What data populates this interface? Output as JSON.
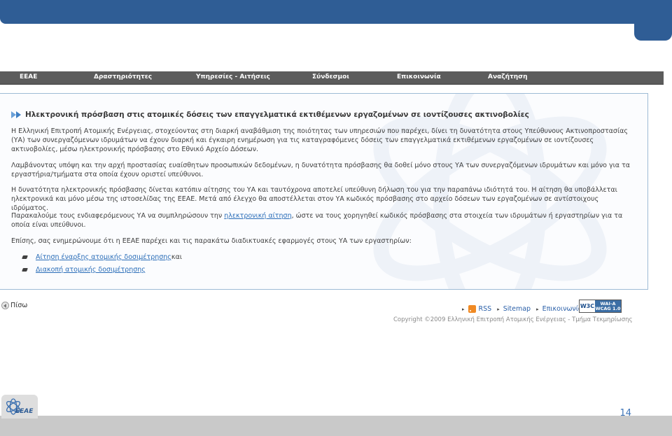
{
  "nav": {
    "items": [
      {
        "label": "ΕΕΑΕ"
      },
      {
        "label": "Δραστηριότητες"
      },
      {
        "label": "Υπηρεσίες - Αιτήσεις"
      },
      {
        "label": "Σύνδεσμοι"
      },
      {
        "label": "Επικοινωνία"
      },
      {
        "label": "Αναζήτηση"
      }
    ]
  },
  "content": {
    "heading": "Ηλεκτρονική πρόσβαση στις ατομικές δόσεις των επαγγελματικά εκτιθέμενων εργαζομένων σε ιοντίζουσες ακτινοβολίες",
    "p1": "Η Ελληνική Επιτροπή Ατομικής Ενέργειας, στοχεύοντας στη διαρκή αναβάθμιση της ποιότητας των υπηρεσιών που παρέχει, δίνει τη δυνατότητα στους Υπεύθυνους Ακτινοπροστασίας (ΥΑ) των συνεργαζόμενων ιδρυμάτων να έχουν διαρκή και έγκαιρη ενημέρωση για τις καταγραφόμενες δόσεις των επαγγελματικά εκτιθέμενων εργαζομένων σε ιοντίζουσες ακτινοβολίες, μέσω ηλεκτρονικής πρόσβασης στο Εθνικό Αρχείο Δόσεων.",
    "p2": "Λαμβάνοντας υπόψη και την αρχή προστασίας ευαίσθητων προσωπικών δεδομένων, η δυνατότητα πρόσβασης θα δοθεί μόνο στους ΥΑ των συνεργαζόμενων ιδρυμάτων και μόνο για τα εργαστήρια/τμήματα στα οποία έχουν οριστεί υπεύθυνοι.",
    "p3": "Η δυνατότητα ηλεκτρονικής πρόσβασης δίνεται κατόπιν αίτησης του ΥΑ και ταυτόχρονα αποτελεί υπεύθυνη δήλωση του για την παραπάνω ιδιότητά του. Η αίτηση θα υποβάλλεται ηλεκτρονικά και μόνο μέσω της ιστοσελίδας της ΕΕΑΕ. Μετά από έλεγχο θα αποστέλλεται στον ΥΑ κωδικός πρόσβασης στο αρχείο δόσεων των εργαζομένων σε αντίστοιχους ιδρύματος.",
    "p4_before": "Παρακαλούμε τους ενδιαφερόμενους ΥΑ να συμπληρώσουν την ",
    "p4_link": "ηλεκτρονική αίτηση",
    "p4_after": ", ώστε να τους χορηγηθεί κωδικός πρόσβασης στα στοιχεία των ιδρυμάτων ή εργαστηρίων για τα οποία είναι υπεύθυνοι.",
    "p5": "Επίσης, σας ενημερώνουμε ότι η ΕΕΑΕ παρέχει και τις παρακάτω διαδικτυακές εφαρμογές στους ΥΑ των εργαστηρίων:",
    "bullets": [
      {
        "link": "Αίτηση έναρξης ατομικής δοσιμέτρησης",
        "suffix": " και"
      },
      {
        "link": "Διακοπή ατομικής δοσιμέτρησης",
        "suffix": ""
      }
    ]
  },
  "footer": {
    "back": "Πίσω",
    "rss": "RSS",
    "sitemap": "Sitemap",
    "contact": "Επικοινωνία",
    "wai_left": "W3C",
    "wai_top": "WAI-A",
    "wai_bottom": "WCAG 1.0",
    "copyright": "Copyright ©2009 Ελληνική Επιτροπή Ατομικής Ενέργειας - Τμήμα Τεκμηρίωσης"
  },
  "slide": {
    "page_number": "14",
    "logo_text": "ΕΕΑΕ"
  },
  "colors": {
    "top_bar": "#2f5d95",
    "nav_bg": "#5c5c5c",
    "link": "#2a6db8",
    "page_number": "#3d74b8"
  }
}
